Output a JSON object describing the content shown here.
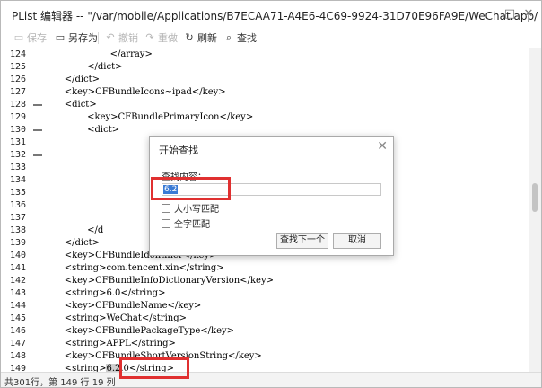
{
  "window": {
    "title": "PList 编辑器 -- \"/var/mobile/Applications/B7ECAA71-A4E6-4C69-9924-31D70E96FA9E/WeChat.app/",
    "min_glyph": "□",
    "close_glyph": "✕"
  },
  "toolbar": {
    "save": "保存",
    "save_as": "另存为",
    "undo": "撤销",
    "redo": "重做",
    "refresh": "刷新",
    "find": "查找"
  },
  "lines": [
    {
      "n": "124",
      "text": "                    </array>",
      "fold": false
    },
    {
      "n": "125",
      "text": "            </dict>",
      "fold": false
    },
    {
      "n": "126",
      "text": "    </dict>",
      "fold": false
    },
    {
      "n": "127",
      "text": "    <key>CFBundleIcons~ipad</key>",
      "fold": false
    },
    {
      "n": "128",
      "text": "    <dict>",
      "fold": true
    },
    {
      "n": "129",
      "text": "            <key>CFBundlePrimaryIcon</key>",
      "fold": false
    },
    {
      "n": "130",
      "text": "            <dict>",
      "fold": true
    },
    {
      "n": "131",
      "text": "",
      "fold": false
    },
    {
      "n": "132",
      "text": "",
      "fold": true
    },
    {
      "n": "133",
      "text": "",
      "fold": false
    },
    {
      "n": "134",
      "text": "",
      "fold": false
    },
    {
      "n": "135",
      "text": "",
      "fold": false
    },
    {
      "n": "136",
      "text": "",
      "fold": false
    },
    {
      "n": "137",
      "text": "",
      "fold": false
    },
    {
      "n": "138",
      "text": "            </d",
      "fold": false
    },
    {
      "n": "139",
      "text": "    </dict>",
      "fold": false
    },
    {
      "n": "140",
      "text": "    <key>CFBundleIdentifier</key>",
      "fold": false
    },
    {
      "n": "141",
      "text": "    <string>com.tencent.xin</string>",
      "fold": false
    },
    {
      "n": "142",
      "text": "    <key>CFBundleInfoDictionaryVersion</key>",
      "fold": false
    },
    {
      "n": "143",
      "text": "    <string>6.0</string>",
      "fold": false
    },
    {
      "n": "144",
      "text": "    <key>CFBundleName</key>",
      "fold": false
    },
    {
      "n": "145",
      "text": "    <string>WeChat</string>",
      "fold": false
    },
    {
      "n": "146",
      "text": "    <key>CFBundlePackageType</key>",
      "fold": false
    },
    {
      "n": "147",
      "text": "    <string>APPL</string>",
      "fold": false
    },
    {
      "n": "148",
      "text": "    <key>CFBundleShortVersionString</key>",
      "fold": false
    },
    {
      "n": "149",
      "text": "    <string>6.2.0</string>",
      "fold": false
    }
  ],
  "line149": {
    "pre": "    <string>",
    "hl": "6.2",
    "post": ".0</string>"
  },
  "status": "共301行，第 149 行 19 列",
  "find_dialog": {
    "title": "开始查找",
    "label": "查找内容：",
    "value": "6.2",
    "case": "大小写匹配",
    "whole": "全字匹配",
    "find_next": "查找下一个",
    "cancel": "取消"
  }
}
